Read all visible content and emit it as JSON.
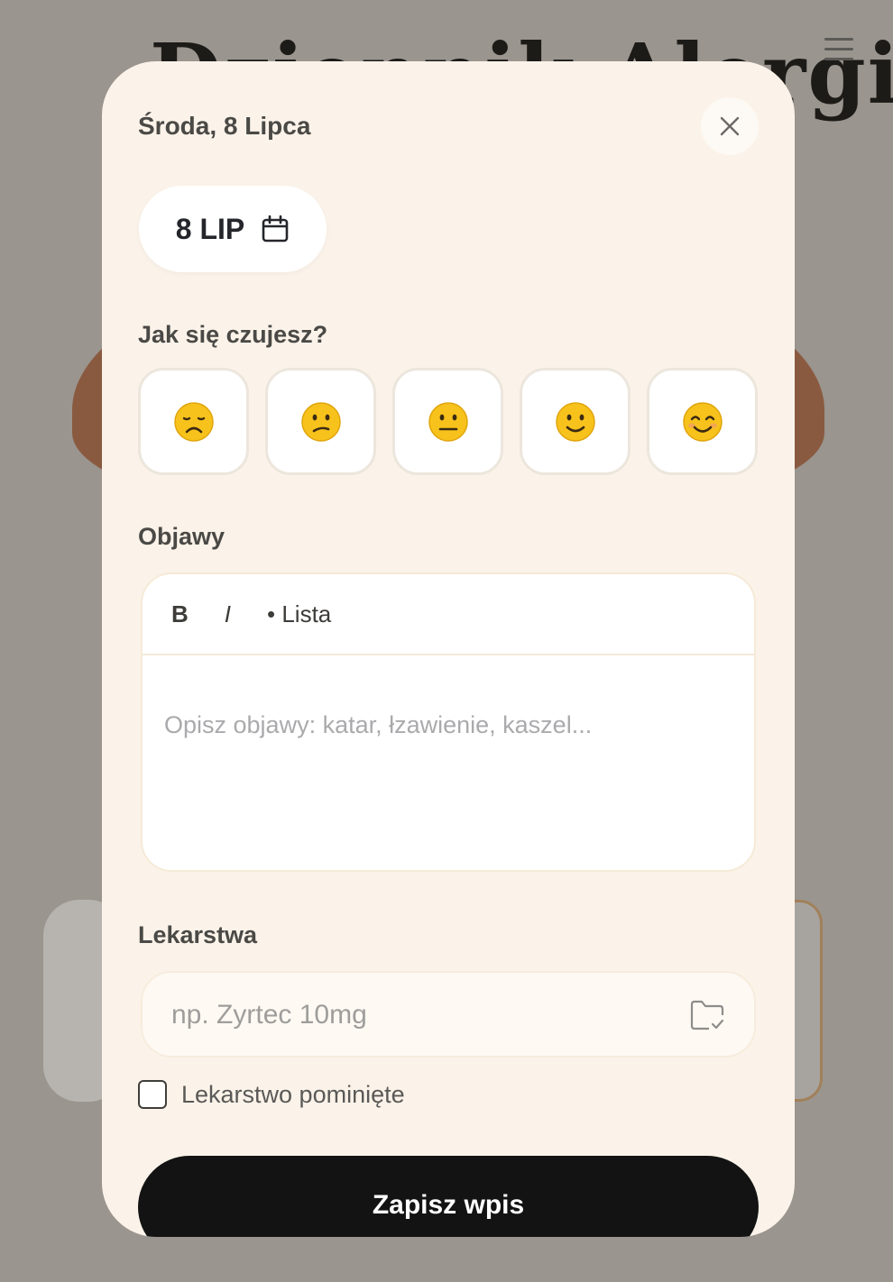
{
  "background": {
    "title": "Dziennik Alergii",
    "menu_icon": "hamburger-icon"
  },
  "modal": {
    "date_heading": "Środa, 8 Lipca",
    "close_icon": "close-icon",
    "date_pill": {
      "label": "8 LIP",
      "icon": "calendar-icon"
    },
    "mood": {
      "label": "Jak się czujesz?",
      "options": [
        {
          "emoji": "😞",
          "icon": "disappointed-face-icon"
        },
        {
          "emoji": "😕",
          "icon": "confused-face-icon"
        },
        {
          "emoji": "😐",
          "icon": "neutral-face-icon"
        },
        {
          "emoji": "🙂",
          "icon": "slightly-smiling-face-icon"
        },
        {
          "emoji": "😊",
          "icon": "smiling-face-icon"
        }
      ]
    },
    "symptoms": {
      "label": "Objawy",
      "toolbar": {
        "bold": "B",
        "italic": "I",
        "list": "• Lista"
      },
      "placeholder": "Opisz objawy: katar, łzawienie, kaszel..."
    },
    "medicines": {
      "label": "Lekarstwa",
      "placeholder": "np. Zyrtec 10mg",
      "icon": "folder-check-icon",
      "skipped_label": "Lekarstwo pominięte",
      "skipped_checked": false
    },
    "save_label": "Zapisz wpis"
  },
  "colors": {
    "overlay": "#9a958e",
    "modal_bg": "#fbf3e9",
    "button_bg": "#131313",
    "accent_blob": "#8a5a40"
  }
}
